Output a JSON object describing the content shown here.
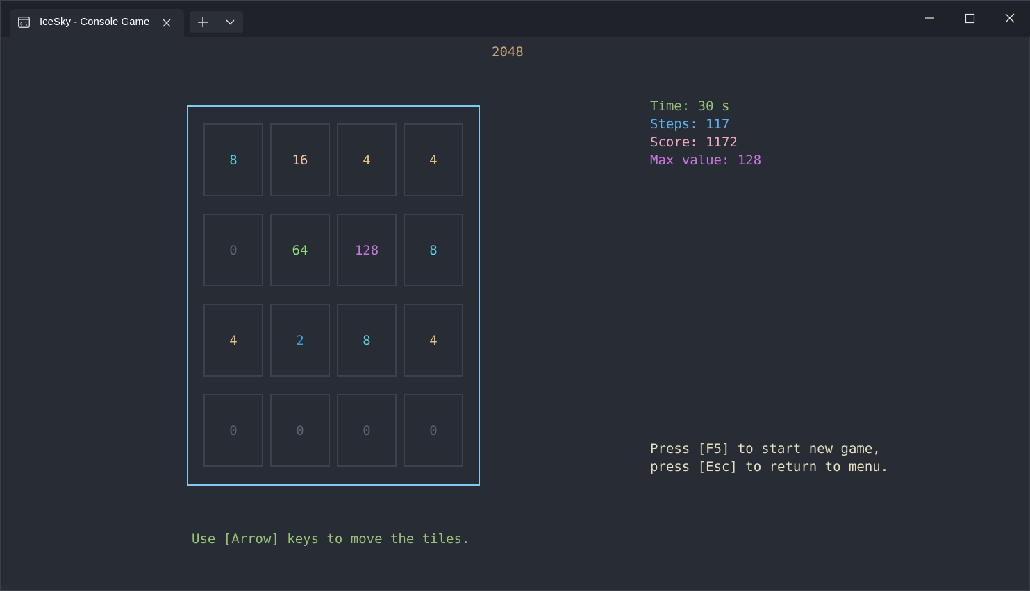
{
  "window": {
    "tab_title": "IceSky - Console Game",
    "tab_icon": "terminal-icon"
  },
  "game": {
    "title": "2048",
    "board": [
      [
        "8",
        "16",
        "4",
        "4"
      ],
      [
        "0",
        "64",
        "128",
        "8"
      ],
      [
        "4",
        "2",
        "8",
        "4"
      ],
      [
        "0",
        "0",
        "0",
        "0"
      ]
    ],
    "tile_colors": {
      "0": "#5c6370",
      "2": "#3d9ee6",
      "4": "#e5c07b",
      "8": "#56d4e0",
      "16": "#f0c6a0",
      "64": "#8ee07b",
      "128": "#c678dd"
    }
  },
  "stats": {
    "time": "Time: 30 s",
    "steps": "Steps: 117",
    "score": "Score: 1172",
    "max_value": "Max value: 128"
  },
  "help": {
    "line1": "Press [F5] to start new game,",
    "line2": "press [Esc] to return to menu."
  },
  "hint": "Use [Arrow] keys to move the tiles."
}
